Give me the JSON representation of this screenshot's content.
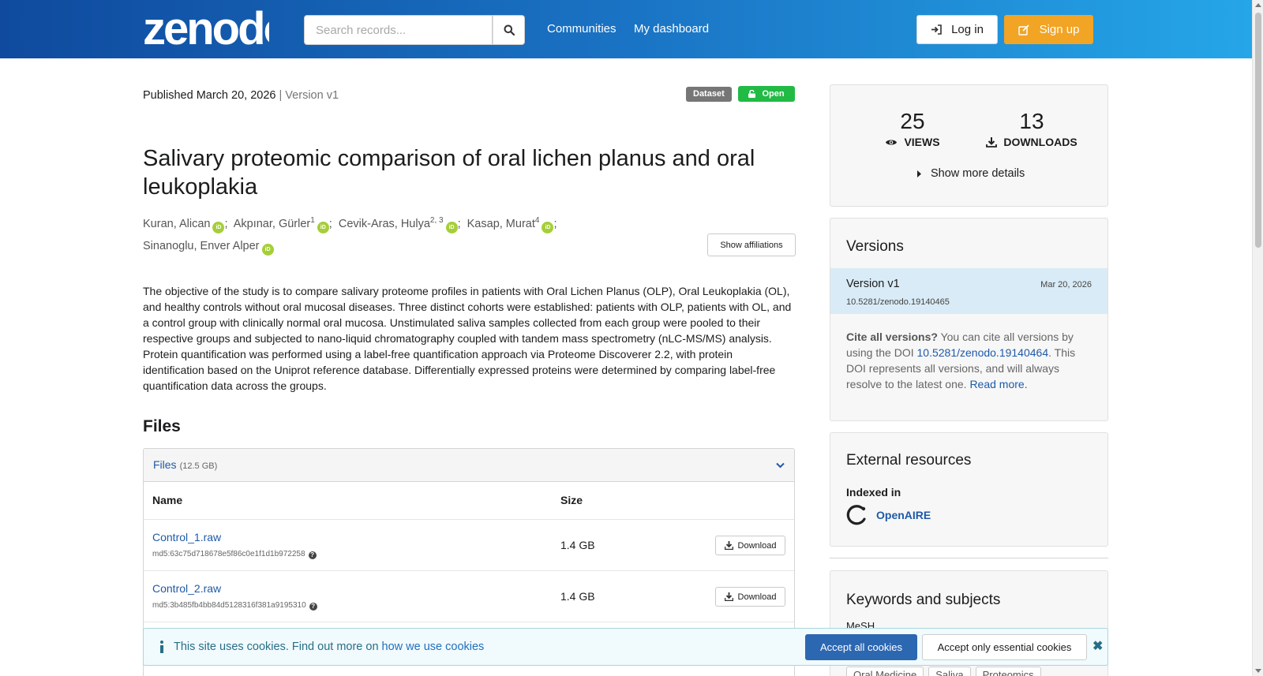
{
  "header": {
    "logo_text": "zenodo",
    "search_placeholder": "Search records...",
    "nav": [
      "Communities",
      "My dashboard"
    ],
    "login_label": "Log in",
    "signup_label": "Sign up"
  },
  "record": {
    "published_label": "Published March 20, 2026",
    "version_label": "| Version v1",
    "badge_type": "Dataset",
    "badge_access": "Open",
    "title": "Salivary proteomic comparison of oral lichen planus and oral leukoplakia",
    "authors": [
      {
        "name": "Kuran, Alican",
        "sup": "",
        "orcid": true
      },
      {
        "name": "Akpınar, Gürler",
        "sup": "1",
        "orcid": true
      },
      {
        "name": "Cevik-Aras, Hulya",
        "sup": "2, 3",
        "orcid": true
      },
      {
        "name": "Kasap, Murat",
        "sup": "4",
        "orcid": true
      },
      {
        "name": "Sinanoglu, Enver Alper",
        "sup": "",
        "orcid": true
      }
    ],
    "show_affiliations": "Show affiliations",
    "description": "The objective of the study is to compare salivary proteome profiles in patients with Oral Lichen Planus (OLP), Oral Leukoplakia (OL), and healthy controls without oral mucosal diseases. Three distinct cohorts were established: patients with OLP, patients with OL, and a control group with clinically normal oral mucosa. Unstimulated saliva samples collected from each group were pooled to their respective groups and subjected to nano-liquid chromatography coupled with tandem mass spectrometry (nLC-MS/MS) analysis. Protein quantification was performed using a label-free quantification approach via Proteome Discoverer 2.2, with protein identification based on the Uniprot reference database. Differentially expressed proteins were determined by comparing label-free quantification data across the groups."
  },
  "files": {
    "heading": "Files",
    "panel_label": "Files",
    "total_size": "(12.5 GB)",
    "col_name": "Name",
    "col_size": "Size",
    "download_label": "Download",
    "rows": [
      {
        "name": "Control_1.raw",
        "md5": "md5:63c75d718678e5f86c0e1f1d1b972258",
        "size": "1.4 GB"
      },
      {
        "name": "Control_2.raw",
        "md5": "md5:3b485fb4bb84d5128316f381a9195310",
        "size": "1.4 GB"
      }
    ]
  },
  "stats": {
    "views": "25",
    "views_label": "VIEWS",
    "downloads": "13",
    "downloads_label": "DOWNLOADS",
    "more_details": "Show more details"
  },
  "versions": {
    "heading": "Versions",
    "current_name": "Version v1",
    "current_date": "Mar 20, 2026",
    "current_doi": "10.5281/zenodo.19140465",
    "cite_bold": "Cite all versions?",
    "cite_text_1": " You can cite all versions by using the DOI ",
    "cite_doi": "10.5281/zenodo.19140464",
    "cite_text_2": ". This DOI represents all versions, and will always resolve to the latest one. ",
    "read_more": "Read more."
  },
  "external": {
    "heading": "External resources",
    "indexed_in": "Indexed in",
    "source": "OpenAIRE"
  },
  "keywords": {
    "heading": "Keywords and subjects",
    "scheme": "MeSH",
    "tags": [
      "Oral Medicine",
      "Saliva",
      "Proteomics"
    ]
  },
  "cookie": {
    "message": "This site uses cookies. Find out more on ",
    "link": "how we use cookies",
    "accept_all": "Accept all cookies",
    "accept_essential": "Accept only essential cookies"
  },
  "colors": {
    "header_start": "#0f4a9e",
    "header_end": "#25a6e8",
    "signup": "#f2a424",
    "open_badge": "#21ba45",
    "orcid": "#a6ce39",
    "link": "#1e5aa8"
  }
}
